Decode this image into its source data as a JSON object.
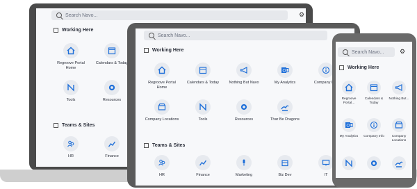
{
  "search": {
    "placeholder": "Search Navo..."
  },
  "sections": {
    "working_here": "Working Here",
    "teams_sites": "Teams & Sites"
  },
  "tiles": {
    "regroove": "Regroove Portal Home",
    "calendars": "Calendars & Today",
    "tools": "Tools",
    "resources": "Resources",
    "hr": "HR",
    "finance": "Finance",
    "nothing_but_navo": "Nothing But Navo",
    "my_analytics": "My Analytics",
    "company_info": "Company Info",
    "company_locations": "Company Locations",
    "thar_be_dragons": "Thar Be Dragons",
    "marketing": "Marketing",
    "bizdev": "Biz Dev",
    "it": "IT"
  },
  "phone_tiles": {
    "regroove": "Regroove Portal...",
    "calendars": "Calendars & Today",
    "nothing": "Nothing But...",
    "analytics": "My Analytics",
    "company_info": "Company Info",
    "locations": "Company Locations"
  },
  "colors": {
    "accent": "#1e6fd9",
    "tile_bg": "#e7eaef",
    "page_bg": "#f7f8fa"
  }
}
